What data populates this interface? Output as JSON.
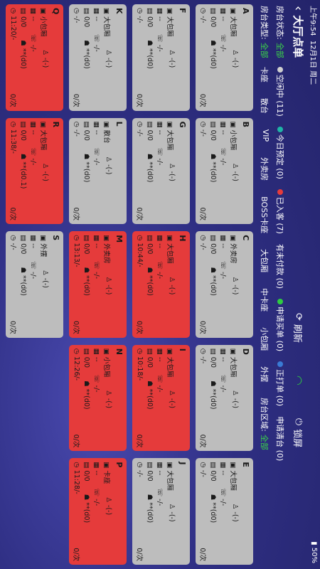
{
  "status": {
    "time": "上午9:54",
    "date": "12月1日 周二",
    "battery": "50%"
  },
  "header": {
    "back_icon": "chevron-left-icon",
    "title": "大厅点单",
    "refresh_label": "刷新",
    "lock_label": "锁屏"
  },
  "filters": {
    "status_label": "房台状态:",
    "status_all": "全部",
    "stats": [
      {
        "label": "空闲中 (11)",
        "color": "#cfcfcf"
      },
      {
        "label": "今日预定 (0)",
        "color": "#1fb5a6"
      },
      {
        "label": "已入客 (7)",
        "color": "#e53b3b"
      },
      {
        "label": "有未付款 (0)",
        "color": ""
      },
      {
        "label": "申请买单 (0)",
        "color": "#2ecc40"
      },
      {
        "label": "正打单 (0)",
        "color": "#3a7bd5"
      },
      {
        "label": "申请清台 (0)",
        "color": ""
      }
    ],
    "type_label": "房台类型:",
    "type_all": "全部",
    "types": [
      "卡座",
      "散台",
      "VIP",
      "外卖房",
      "BOSS卡座",
      "大包厢",
      "中卡座",
      "小包厢",
      "外摆"
    ],
    "area_label": "房台区域:",
    "area_all": "全部"
  },
  "tables": [
    {
      "id": "A",
      "type": "大包厢",
      "state": "gray",
      "l1": "--",
      "l2": "0/0",
      "l3": "-/-",
      "r1": "-(-)",
      "r2": "-/-",
      "r3": "**(d0)",
      "amount": "0/次"
    },
    {
      "id": "B",
      "type": "小包厢",
      "state": "gray",
      "l1": "--",
      "l2": "0/0",
      "l3": "-/-",
      "r1": "-(-)",
      "r2": "-/-",
      "r3": "**(d0)",
      "amount": "0/次"
    },
    {
      "id": "C",
      "type": "外卖房",
      "state": "gray",
      "l1": "--",
      "l2": "0/0",
      "l3": "-/-",
      "r1": "-(-)",
      "r2": "-/-",
      "r3": "**(d0)",
      "amount": "0/次"
    },
    {
      "id": "D",
      "type": "大包厢",
      "state": "gray",
      "l1": "--",
      "l2": "0/0",
      "l3": "-/-",
      "r1": "-(-)",
      "r2": "-/-",
      "r3": "**(d0)",
      "amount": "0/次"
    },
    {
      "id": "E",
      "type": "大包厢",
      "state": "gray",
      "l1": "--",
      "l2": "0/0",
      "l3": "-/-",
      "r1": "-(-)",
      "r2": "-/-",
      "r3": "**(d0)",
      "amount": "0/次"
    },
    {
      "id": "F",
      "type": "大包厢",
      "state": "gray",
      "l1": "--",
      "l2": "0/0",
      "l3": "-/-",
      "r1": "-(-)",
      "r2": "-/-",
      "r3": "**(d0)",
      "amount": "0/次"
    },
    {
      "id": "G",
      "type": "大包厢",
      "state": "gray",
      "l1": "--",
      "l2": "0/0",
      "l3": "-/-",
      "r1": "-(-)",
      "r2": "-/-",
      "r3": "**(d0)",
      "amount": "0/次"
    },
    {
      "id": "H",
      "type": "大包厢",
      "state": "red",
      "l1": "--",
      "l2": "0/0",
      "l3": "10:44/-",
      "r1": "-(-)",
      "r2": "-/-",
      "r3": "**(d0)",
      "amount": "0/次"
    },
    {
      "id": "I",
      "type": "大包厢",
      "state": "red",
      "l1": "--",
      "l2": "0/0",
      "l3": "10:18/-",
      "r1": "-(-)",
      "r2": "-/-",
      "r3": "**(d0)",
      "amount": "0/次"
    },
    {
      "id": "J",
      "type": "大包厢",
      "state": "gray",
      "l1": "--",
      "l2": "0/0",
      "l3": "-/-",
      "r1": "-(-)",
      "r2": "-/-",
      "r3": "**(d0)",
      "amount": "0/次"
    },
    {
      "id": "K",
      "type": "大包厢",
      "state": "gray",
      "l1": "--",
      "l2": "0/0",
      "l3": "-/-",
      "r1": "-(-)",
      "r2": "-/-",
      "r3": "**(d0)",
      "amount": "0/次"
    },
    {
      "id": "L",
      "type": "散台",
      "state": "gray",
      "l1": "--",
      "l2": "0/0",
      "l3": "-/-",
      "r1": "-(-)",
      "r2": "-/-",
      "r3": "**(d0)",
      "amount": "0/次"
    },
    {
      "id": "M",
      "type": "外卖房",
      "state": "red",
      "l1": "--",
      "l2": "0/0",
      "l3": "13:13/-",
      "r1": "-(-)",
      "r2": "-/-",
      "r3": "**(d0)",
      "amount": "0/次"
    },
    {
      "id": "N",
      "type": "小包厢",
      "state": "red",
      "l1": "--",
      "l2": "0/0",
      "l3": "12:26/-",
      "r1": "-(-)",
      "r2": "-/-",
      "r3": "**(d0)",
      "amount": "0/次"
    },
    {
      "id": "P",
      "type": "卡座",
      "state": "red",
      "l1": "--",
      "l2": "0/0",
      "l3": "11:28/-",
      "r1": "-(-)",
      "r2": "-/-",
      "r3": "**(d0)",
      "amount": "0/次"
    },
    {
      "id": "Q",
      "type": "小包厢",
      "state": "red",
      "l1": "--",
      "l2": "0/0",
      "l3": "11:20/-",
      "r1": "-(-)",
      "r2": "-/-",
      "r3": "**(d0)",
      "amount": "0/次"
    },
    {
      "id": "R",
      "type": "大包厢",
      "state": "red",
      "l1": "--",
      "l2": "0/0",
      "l3": "11:38/-",
      "r1": "-(-)",
      "r2": "-/-",
      "r3": "**(d0.1)",
      "amount": "0/次"
    },
    {
      "id": "S",
      "type": "外摆",
      "state": "gray",
      "l1": "--",
      "l2": "0/0",
      "l3": "-/-",
      "r1": "-(-)",
      "r2": "-/-",
      "r3": "**(d0)",
      "amount": "0/次"
    }
  ]
}
